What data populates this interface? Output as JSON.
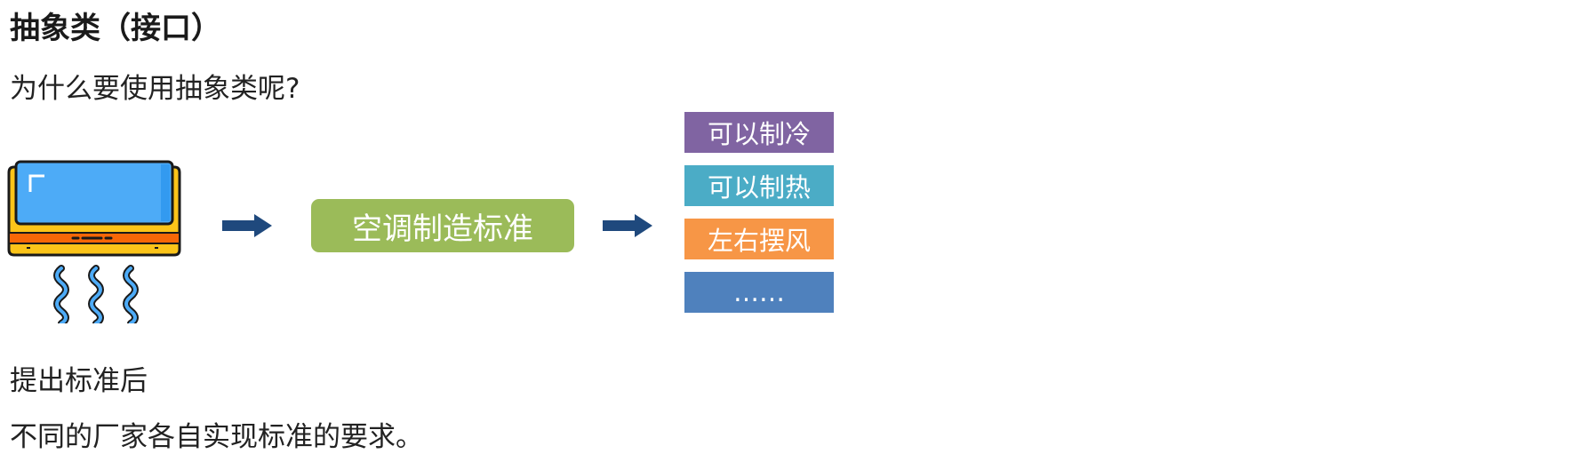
{
  "heading": "抽象类（接口）",
  "question": "为什么要使用抽象类呢?",
  "standard_label": "空调制造标准",
  "features": [
    {
      "label": "可以制冷",
      "color": "#8064a2"
    },
    {
      "label": "可以制热",
      "color": "#4bacc6"
    },
    {
      "label": "左右摆风",
      "color": "#f79646"
    },
    {
      "label": "……",
      "color": "#4f81bd"
    }
  ],
  "after_standard": "提出标准后",
  "conclusion": "不同的厂家各自实现标准的要求。",
  "icons": {
    "air_conditioner": "air-conditioner-icon",
    "arrow": "arrow-right-icon"
  },
  "colors": {
    "arrow": "#1f497d",
    "standard_box": "#9bbb59"
  }
}
